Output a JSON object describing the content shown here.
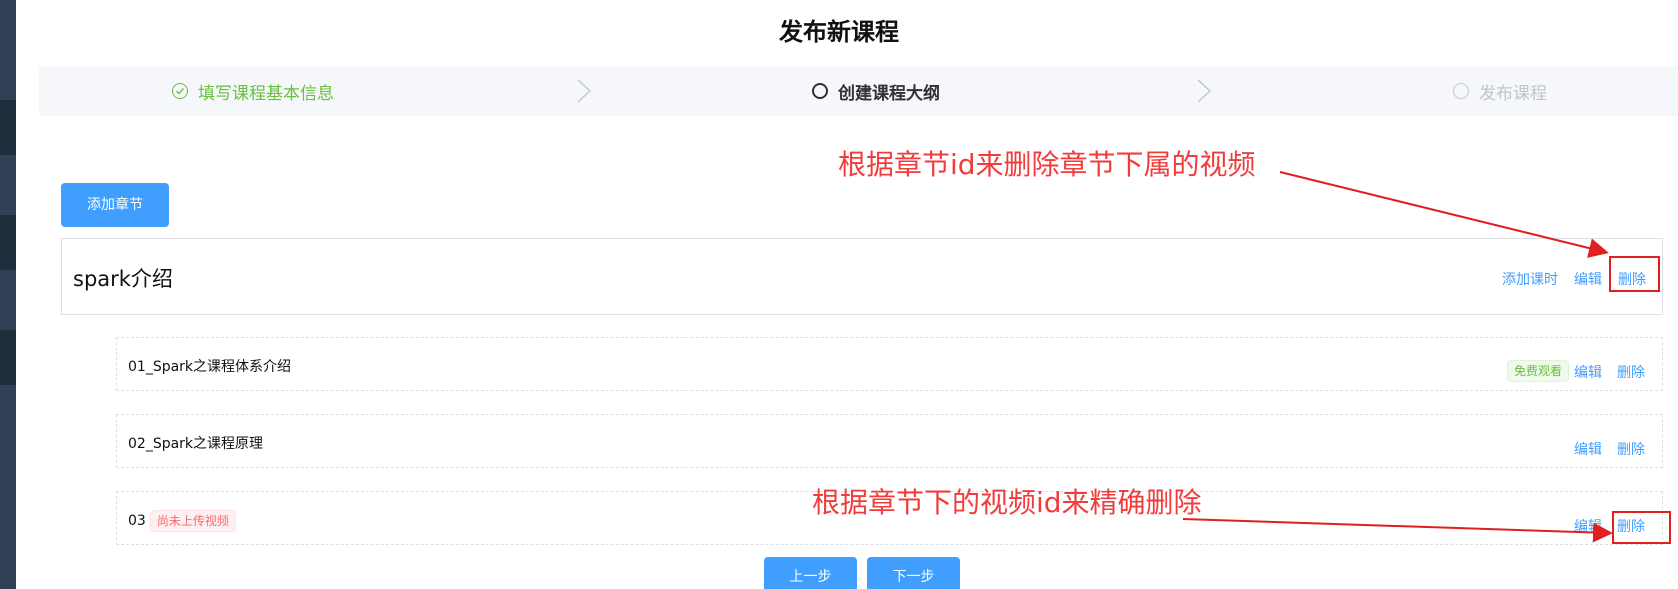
{
  "page": {
    "title": "发布新课程"
  },
  "steps": [
    {
      "label": "填写课程基本信息",
      "state": "done"
    },
    {
      "label": "创建课程大纲",
      "state": "active"
    },
    {
      "label": "发布课程",
      "state": "pending"
    }
  ],
  "toolbar": {
    "add_chapter_label": "添加章节"
  },
  "chapter": {
    "title": "spark介绍",
    "add_lesson_label": "添加课时",
    "edit_label": "编辑",
    "delete_label": "删除"
  },
  "lessons": [
    {
      "title": "01_Spark之课程体系介绍",
      "tag": "免费观看",
      "edit_label": "编辑",
      "delete_label": "删除"
    },
    {
      "title": "02_Spark之课程原理",
      "edit_label": "编辑",
      "delete_label": "删除"
    },
    {
      "title": "03",
      "tag": "尚未上传视频",
      "edit_label": "编辑",
      "delete_label": "删除"
    }
  ],
  "footer": {
    "prev_label": "上一步",
    "next_label": "下一步"
  },
  "annotations": {
    "chapter_note": "根据章节id来删除章节下属的视频",
    "lesson_note": "根据章节下的视频id来精确删除"
  },
  "colors": {
    "primary": "#409eff",
    "success": "#67c23a",
    "danger": "#f56c6c",
    "annotation_red": "#f23c3c"
  }
}
